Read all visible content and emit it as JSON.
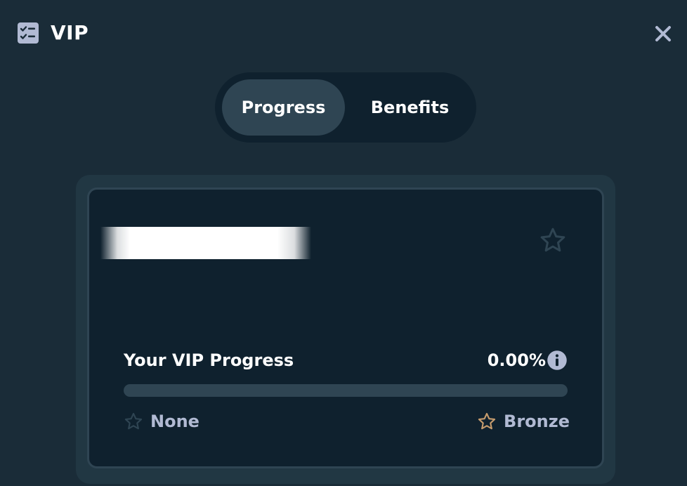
{
  "header": {
    "title": "VIP",
    "icon": "checklist-icon",
    "close_icon": "close-icon"
  },
  "tabs": [
    {
      "label": "Progress",
      "active": true
    },
    {
      "label": "Benefits",
      "active": false
    }
  ],
  "card": {
    "username_redacted": true,
    "star_icon": "star-outline-icon",
    "progress": {
      "label": "Your VIP Progress",
      "value_text": "0.00%",
      "fraction": 0.0,
      "info_icon": "info-icon"
    },
    "tiers": {
      "current": {
        "label": "None",
        "icon": "star-outline-icon",
        "color": "#2f4553"
      },
      "next": {
        "label": "Bronze",
        "icon": "star-outline-icon",
        "color": "#c69c6d"
      }
    }
  },
  "colors": {
    "background": "#1a2c38",
    "card_background": "#0f212e",
    "surface": "#2f4553",
    "muted_text": "#b1bad3",
    "bronze": "#c69c6d"
  }
}
